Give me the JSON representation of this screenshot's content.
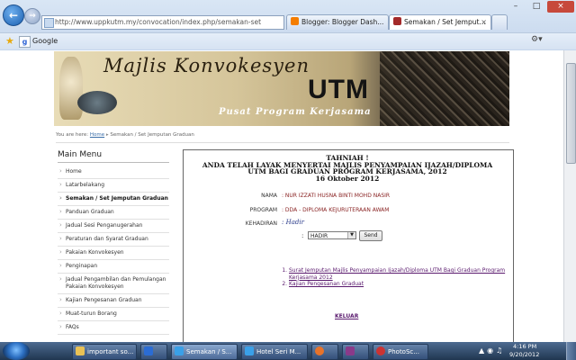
{
  "browser": {
    "address": "http://www.uppkutm.my/convocation/index.php/semakan-set",
    "tabs": [
      {
        "label": "Blogger: Blogger Dash..."
      },
      {
        "label": "Semakan / Set Jemput..."
      }
    ],
    "favorites": {
      "google_label": "Google"
    }
  },
  "banner": {
    "title": "Majlis Konvokesyen",
    "utm": "UTM",
    "subtitle": "Pusat Program Kerjasama"
  },
  "breadcrumb": {
    "prefix": "You are here:",
    "home": "Home",
    "current": "Semakan / Set Jemputan Graduan"
  },
  "sidebar": {
    "title": "Main Menu",
    "items": [
      {
        "label": "Home"
      },
      {
        "label": "Latarbelakang"
      },
      {
        "label": "Semakan / Set Jemputan Graduan"
      },
      {
        "label": "Panduan Graduan"
      },
      {
        "label": "Jadual Sesi Penganugerahan"
      },
      {
        "label": "Peraturan dan Syarat Graduan"
      },
      {
        "label": "Pakaian Konvokesyen"
      },
      {
        "label": "Penginapan"
      },
      {
        "label": "Jadual Pengambilan dan Pemulangan Pakaian Konvokesyen"
      },
      {
        "label": "Kajian Pengesanan Graduan"
      },
      {
        "label": "Muat-turun Borang"
      },
      {
        "label": "FAQs"
      }
    ]
  },
  "content": {
    "heading_lines": [
      "TAHNIAH !",
      "ANDA TELAH LAYAK MENYERTAI MAJLIS PENYAMPAIAN IJAZAH/DIPLOMA",
      "UTM BAGI GRADUAN PROGRAM KERJASAMA, 2012",
      "16 Oktober 2012"
    ],
    "nama_label": "NAMA",
    "nama_value": ": NUR IZZATI HUSNA BINTI MOHD NASIR",
    "program_label": "PROGRAM",
    "program_value": ": DDA - DIPLOMA KEJURUTERAAN AWAM",
    "kehadiran_label": "KEHADIRAN",
    "kehadiran_value": ": Hadir",
    "select_colon": ":",
    "select_value": "HADIR",
    "send_label": "Send",
    "links": [
      {
        "label": "Surat Jemputan Majlis Penyampaian Ijazah/Diploma UTM Bagi Graduan Program Kerjasama 2012"
      },
      {
        "label": "Kajian Pengesanan Graduat"
      }
    ],
    "logout_label": "KELUAR"
  },
  "taskbar": {
    "items": [
      {
        "label": "important so..."
      },
      {
        "label": ""
      },
      {
        "label": "Semakan / S..."
      },
      {
        "label": "Hotel Seri M..."
      },
      {
        "label": ""
      },
      {
        "label": "PhotoSc..."
      }
    ],
    "time": "4:16 PM",
    "date": "9/20/2012"
  },
  "colors": {
    "accent": "#1a5fb0",
    "value_text": "#8a2424",
    "link": "#5a1a6e"
  }
}
